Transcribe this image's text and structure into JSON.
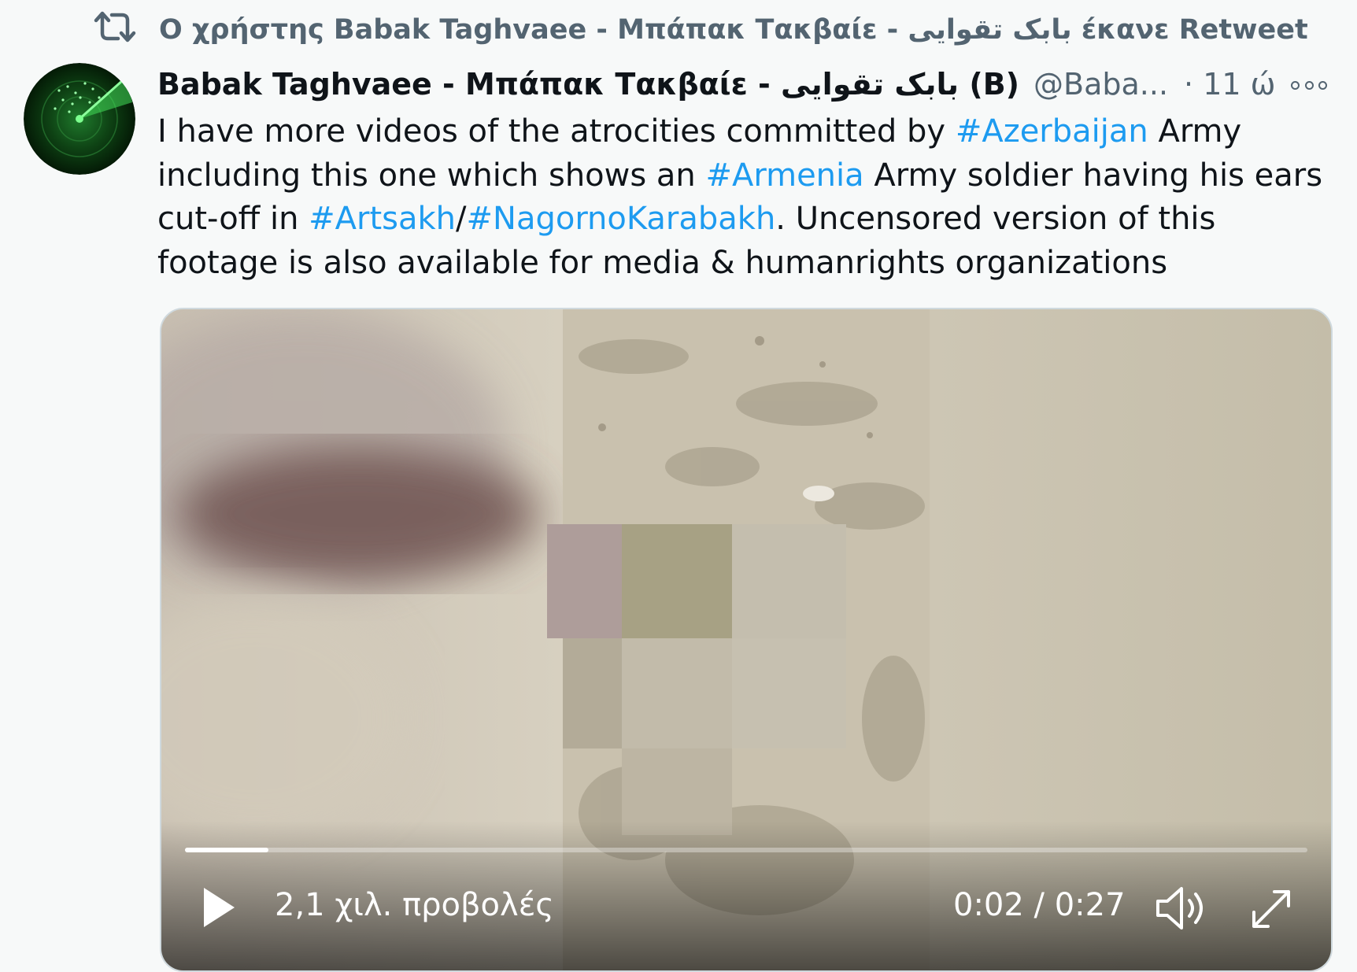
{
  "retweet_banner": {
    "text": "Ο χρήστης Babak Taghvaee - Μπάπακ Τακβαίε - بابک تقوایی έκανε Retweet",
    "icon": "retweet-icon"
  },
  "tweet": {
    "author_name": "Babak Taghvaee - Μπάπακ Τακβαίε - بابک تقوایی (B)",
    "handle": "@Baba...",
    "time": "· 11 ώ",
    "more_icon": "more-icon",
    "text_segments": [
      {
        "text": "I have more videos of the atrocities committed by "
      },
      {
        "text": "#Azerbaijan",
        "hashtag": true
      },
      {
        "text": " Army including this one which shows an "
      },
      {
        "text": "#Armenia",
        "hashtag": true
      },
      {
        "text": " Army soldier having his ears cut-off in "
      },
      {
        "text": "#Artsakh",
        "hashtag": true
      },
      {
        "text": "/"
      },
      {
        "text": "#NagornoKarabakh",
        "hashtag": true
      },
      {
        "text": ". Uncensored version of this footage is also available for media & humanrights organizations"
      }
    ]
  },
  "video": {
    "progress_fraction": 0.074,
    "views": "2,1 χιλ. προβολές",
    "timecode": "0:02 / 0:27",
    "play_icon": "play-icon",
    "volume_icon": "volume-icon",
    "fullscreen_icon": "fullscreen-icon"
  },
  "colors": {
    "hashtag": "#1d9bf0",
    "secondary_text": "#536471",
    "avatar_green": "#2fd04a"
  }
}
